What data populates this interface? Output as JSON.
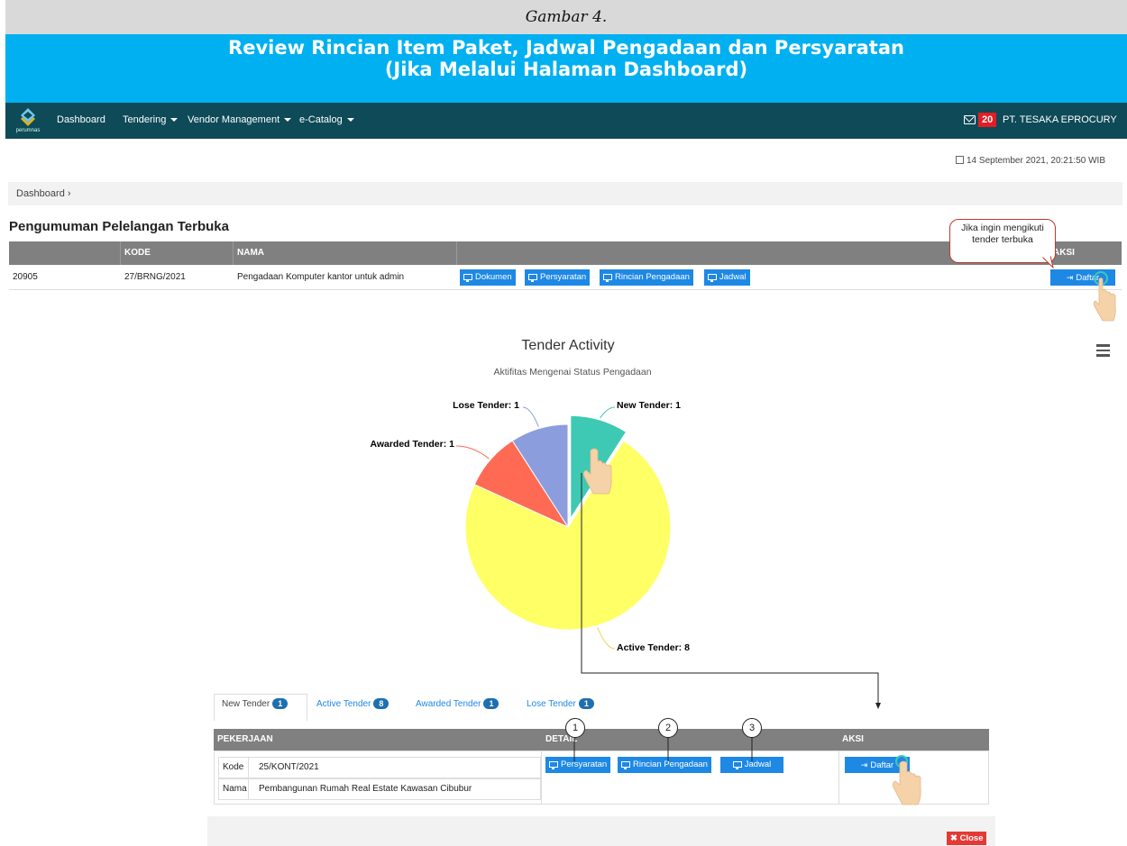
{
  "figure_caption": "Gambar 4.",
  "title": {
    "line1": "Review Rincian Item Paket, Jadwal Pengadaan dan Persyaratan",
    "line2": "(Jika Melalui Halaman Dashboard)"
  },
  "navbar": {
    "logo_text": "perumnas",
    "items": [
      "Dashboard",
      "Tendering",
      "Vendor Management",
      "e-Catalog"
    ],
    "mail_count": "20",
    "company": "PT. TESAKA EPROCURY"
  },
  "date": "14 September 2021, 20:21:50 WIB",
  "breadcrumb": "Dashboard ›",
  "section_title": "Pengumuman Pelelangan Terbuka",
  "table": {
    "headers": [
      "",
      "KODE",
      "NAMA",
      "",
      "AKSI"
    ],
    "row": {
      "id": "20905",
      "kode": "27/BRNG/2021",
      "nama": "Pengadaan Komputer kantor untuk admin"
    },
    "buttons": [
      "Dokumen",
      "Persyaratan",
      "Rincian Pengadaan",
      "Jadwal"
    ],
    "action": "Daftar"
  },
  "callout": "Jika ingin mengikuti tender terbuka",
  "chart_data": {
    "type": "pie",
    "title": "Tender Activity",
    "subtitle": "Aktifitas Mengenai Status Pengadaan",
    "slices": [
      {
        "label": "New Tender: 1",
        "name": "New Tender",
        "value": 1,
        "color": "#3ec9b4"
      },
      {
        "label": "Active Tender: 8",
        "name": "Active Tender",
        "value": 8,
        "color": "#ffff66"
      },
      {
        "label": "Awarded Tender: 1",
        "name": "Awarded Tender",
        "value": 1,
        "color": "#ff6a55"
      },
      {
        "label": "Lose Tender: 1",
        "name": "Lose Tender",
        "value": 1,
        "color": "#8b9ddd"
      }
    ]
  },
  "tabs": [
    {
      "label": "New Tender",
      "count": "1"
    },
    {
      "label": "Active Tender",
      "count": "8"
    },
    {
      "label": "Awarded Tender",
      "count": "1"
    },
    {
      "label": "Lose Tender",
      "count": "1"
    }
  ],
  "detail_table": {
    "headers": [
      "PEKERJAAN",
      "DETAIL",
      "AKSI"
    ],
    "kode_label": "Kode",
    "kode_value": "25/KONT/2021",
    "nama_label": "Nama",
    "nama_value": "Pembangunan Rumah Real Estate Kawasan Cibubur",
    "buttons": [
      "Persyaratan",
      "Rincian Pengadaan",
      "Jadwal"
    ],
    "action": "Daftar",
    "markers": [
      "1",
      "2",
      "3"
    ]
  },
  "close_label": "Close",
  "colors": {
    "title_band": "#00b0f0",
    "navbar": "#0e4a58",
    "button": "#1e88e5",
    "close": "#e53935"
  }
}
